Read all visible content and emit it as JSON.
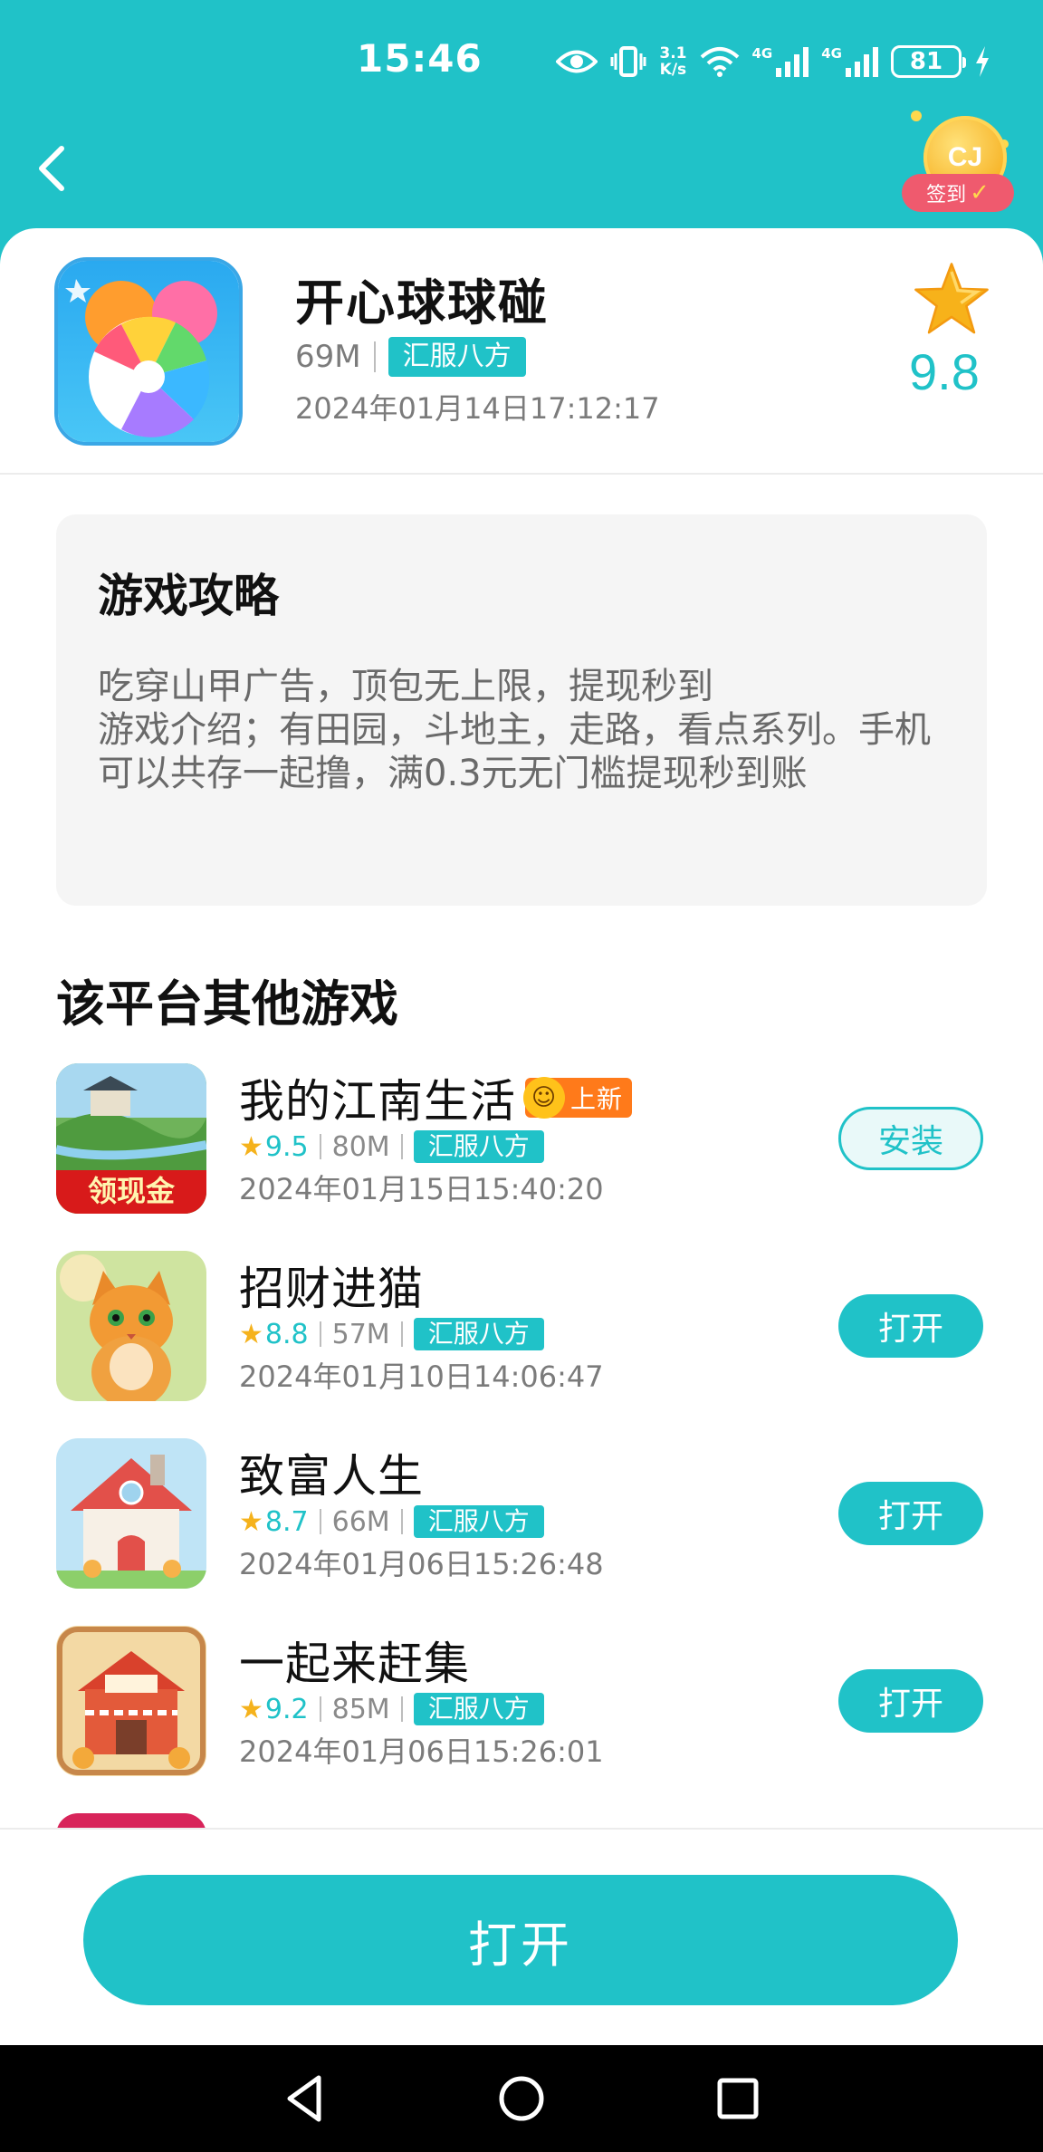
{
  "status_bar": {
    "time": "15:46",
    "net_speed_value": "3.1",
    "net_speed_unit": "K/s",
    "signal_1": "4G",
    "signal_2": "4G",
    "battery": "81"
  },
  "header": {
    "back_icon": "chevron-left-icon",
    "checkin_label": "签到",
    "coin_text": "CJ"
  },
  "app": {
    "name": "开心球球碰",
    "size": "69M",
    "tag": "汇服八方",
    "date": "2024年01月14日17:12:17",
    "rating": "9.8"
  },
  "guide": {
    "title": "游戏攻略",
    "text": "吃穿山甲广告，顶包无上限，提现秒到\n游戏介绍；有田园，斗地主，走路，看点系列。手机可以共存一起撸，满0.3元无门槛提现秒到账"
  },
  "other_games": {
    "title": "该平台其他游戏",
    "items": [
      {
        "name": "我的江南生活",
        "badge": "上新",
        "icon_text": "领现金",
        "rating": "9.5",
        "size": "80M",
        "tag": "汇服八方",
        "date": "2024年01月15日15:40:20",
        "button": "安装",
        "button_type": "install"
      },
      {
        "name": "招财进猫",
        "rating": "8.8",
        "size": "57M",
        "tag": "汇服八方",
        "date": "2024年01月10日14:06:47",
        "button": "打开",
        "button_type": "open"
      },
      {
        "name": "致富人生",
        "rating": "8.7",
        "size": "66M",
        "tag": "汇服八方",
        "date": "2024年01月06日15:26:48",
        "button": "打开",
        "button_type": "open"
      },
      {
        "name": "一起来赶集",
        "rating": "9.2",
        "size": "85M",
        "tag": "汇服八方",
        "date": "2024年01月06日15:26:01",
        "button": "打开",
        "button_type": "open"
      }
    ]
  },
  "bottom": {
    "open_label": "打开"
  },
  "colors": {
    "accent": "#20c2c8",
    "star": "#f5b21c",
    "badge_new": "#ff7a1a",
    "checkin_tag": "#ef5a6e"
  },
  "navigation": {
    "back": "triangle-back-icon",
    "home": "circle-home-icon",
    "recents": "square-recents-icon"
  }
}
